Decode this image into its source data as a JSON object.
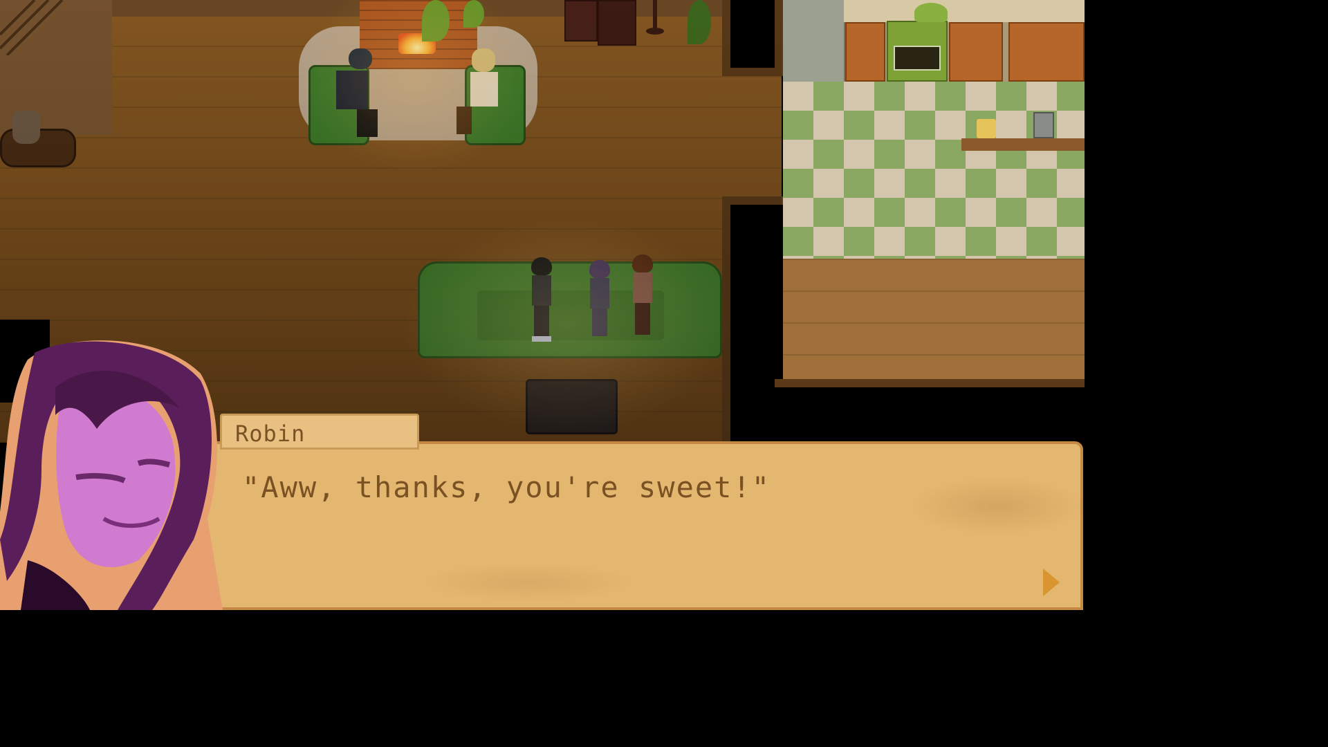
{
  "dialogue": {
    "speaker": "Robin",
    "line": "\"Aww, thanks, you're sweet!\"",
    "continue_icon": "triangle-arrow-right-icon"
  },
  "colors": {
    "dialog_bg": "#e4b770",
    "dialog_border": "#c48a44",
    "dialog_text": "#7a5122",
    "portrait_purple": "#7a2f7a",
    "sofa_green": "#437f2c"
  }
}
